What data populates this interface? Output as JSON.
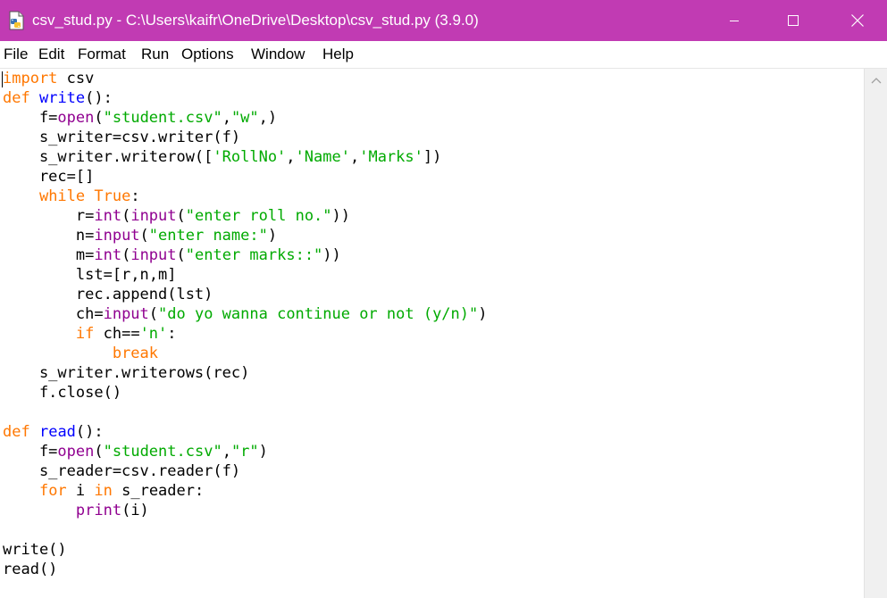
{
  "window": {
    "title": "csv_stud.py - C:\\Users\\kaifr\\OneDrive\\Desktop\\csv_stud.py (3.9.0)",
    "app_icon": "python-file-icon",
    "controls": [
      "minimize-icon",
      "maximize-icon",
      "close-icon"
    ]
  },
  "menu": {
    "items": [
      "File",
      "Edit",
      "Format",
      "Run",
      "Options",
      "Window",
      "Help"
    ]
  },
  "colors": {
    "titlebar": "#c13bb3",
    "keyword": "#ff7700",
    "builtin": "#900090",
    "string": "#00aa00",
    "definition": "#0000ff"
  },
  "editor": {
    "lines": [
      [
        {
          "t": "import",
          "c": "kw"
        },
        {
          "t": " csv",
          "c": ""
        }
      ],
      [
        {
          "t": "def",
          "c": "kw"
        },
        {
          "t": " ",
          "c": ""
        },
        {
          "t": "write",
          "c": "df"
        },
        {
          "t": "():",
          "c": ""
        }
      ],
      [
        {
          "t": "    f=",
          "c": ""
        },
        {
          "t": "open",
          "c": "bi"
        },
        {
          "t": "(",
          "c": ""
        },
        {
          "t": "\"student.csv\"",
          "c": "st"
        },
        {
          "t": ",",
          "c": ""
        },
        {
          "t": "\"w\"",
          "c": "st"
        },
        {
          "t": ",)",
          "c": ""
        }
      ],
      [
        {
          "t": "    s_writer=csv.writer(f)",
          "c": ""
        }
      ],
      [
        {
          "t": "    s_writer.writerow([",
          "c": ""
        },
        {
          "t": "'RollNo'",
          "c": "st"
        },
        {
          "t": ",",
          "c": ""
        },
        {
          "t": "'Name'",
          "c": "st"
        },
        {
          "t": ",",
          "c": ""
        },
        {
          "t": "'Marks'",
          "c": "st"
        },
        {
          "t": "])",
          "c": ""
        }
      ],
      [
        {
          "t": "    rec=[]",
          "c": ""
        }
      ],
      [
        {
          "t": "    ",
          "c": ""
        },
        {
          "t": "while",
          "c": "kw"
        },
        {
          "t": " ",
          "c": ""
        },
        {
          "t": "True",
          "c": "kw"
        },
        {
          "t": ":",
          "c": ""
        }
      ],
      [
        {
          "t": "        r=",
          "c": ""
        },
        {
          "t": "int",
          "c": "bi"
        },
        {
          "t": "(",
          "c": ""
        },
        {
          "t": "input",
          "c": "bi"
        },
        {
          "t": "(",
          "c": ""
        },
        {
          "t": "\"enter roll no.\"",
          "c": "st"
        },
        {
          "t": "))",
          "c": ""
        }
      ],
      [
        {
          "t": "        n=",
          "c": ""
        },
        {
          "t": "input",
          "c": "bi"
        },
        {
          "t": "(",
          "c": ""
        },
        {
          "t": "\"enter name:\"",
          "c": "st"
        },
        {
          "t": ")",
          "c": ""
        }
      ],
      [
        {
          "t": "        m=",
          "c": ""
        },
        {
          "t": "int",
          "c": "bi"
        },
        {
          "t": "(",
          "c": ""
        },
        {
          "t": "input",
          "c": "bi"
        },
        {
          "t": "(",
          "c": ""
        },
        {
          "t": "\"enter marks::\"",
          "c": "st"
        },
        {
          "t": "))",
          "c": ""
        }
      ],
      [
        {
          "t": "        lst=[r,n,m]",
          "c": ""
        }
      ],
      [
        {
          "t": "        rec.append(lst)",
          "c": ""
        }
      ],
      [
        {
          "t": "        ch=",
          "c": ""
        },
        {
          "t": "input",
          "c": "bi"
        },
        {
          "t": "(",
          "c": ""
        },
        {
          "t": "\"do yo wanna continue or not (y/n)\"",
          "c": "st"
        },
        {
          "t": ")",
          "c": ""
        }
      ],
      [
        {
          "t": "        ",
          "c": ""
        },
        {
          "t": "if",
          "c": "kw"
        },
        {
          "t": " ch==",
          "c": ""
        },
        {
          "t": "'n'",
          "c": "st"
        },
        {
          "t": ":",
          "c": ""
        }
      ],
      [
        {
          "t": "            ",
          "c": ""
        },
        {
          "t": "break",
          "c": "kw"
        }
      ],
      [
        {
          "t": "    s_writer.writerows(rec)",
          "c": ""
        }
      ],
      [
        {
          "t": "    f.close()",
          "c": ""
        }
      ],
      [],
      [
        {
          "t": "def",
          "c": "kw"
        },
        {
          "t": " ",
          "c": ""
        },
        {
          "t": "read",
          "c": "df"
        },
        {
          "t": "():",
          "c": ""
        }
      ],
      [
        {
          "t": "    f=",
          "c": ""
        },
        {
          "t": "open",
          "c": "bi"
        },
        {
          "t": "(",
          "c": ""
        },
        {
          "t": "\"student.csv\"",
          "c": "st"
        },
        {
          "t": ",",
          "c": ""
        },
        {
          "t": "\"r\"",
          "c": "st"
        },
        {
          "t": ")",
          "c": ""
        }
      ],
      [
        {
          "t": "    s_reader=csv.reader(f)",
          "c": ""
        }
      ],
      [
        {
          "t": "    ",
          "c": ""
        },
        {
          "t": "for",
          "c": "kw"
        },
        {
          "t": " i ",
          "c": ""
        },
        {
          "t": "in",
          "c": "kw"
        },
        {
          "t": " s_reader:",
          "c": ""
        }
      ],
      [
        {
          "t": "        ",
          "c": ""
        },
        {
          "t": "print",
          "c": "bi"
        },
        {
          "t": "(i)",
          "c": ""
        }
      ],
      [],
      [
        {
          "t": "write()",
          "c": ""
        }
      ],
      [
        {
          "t": "read()",
          "c": ""
        }
      ]
    ]
  }
}
